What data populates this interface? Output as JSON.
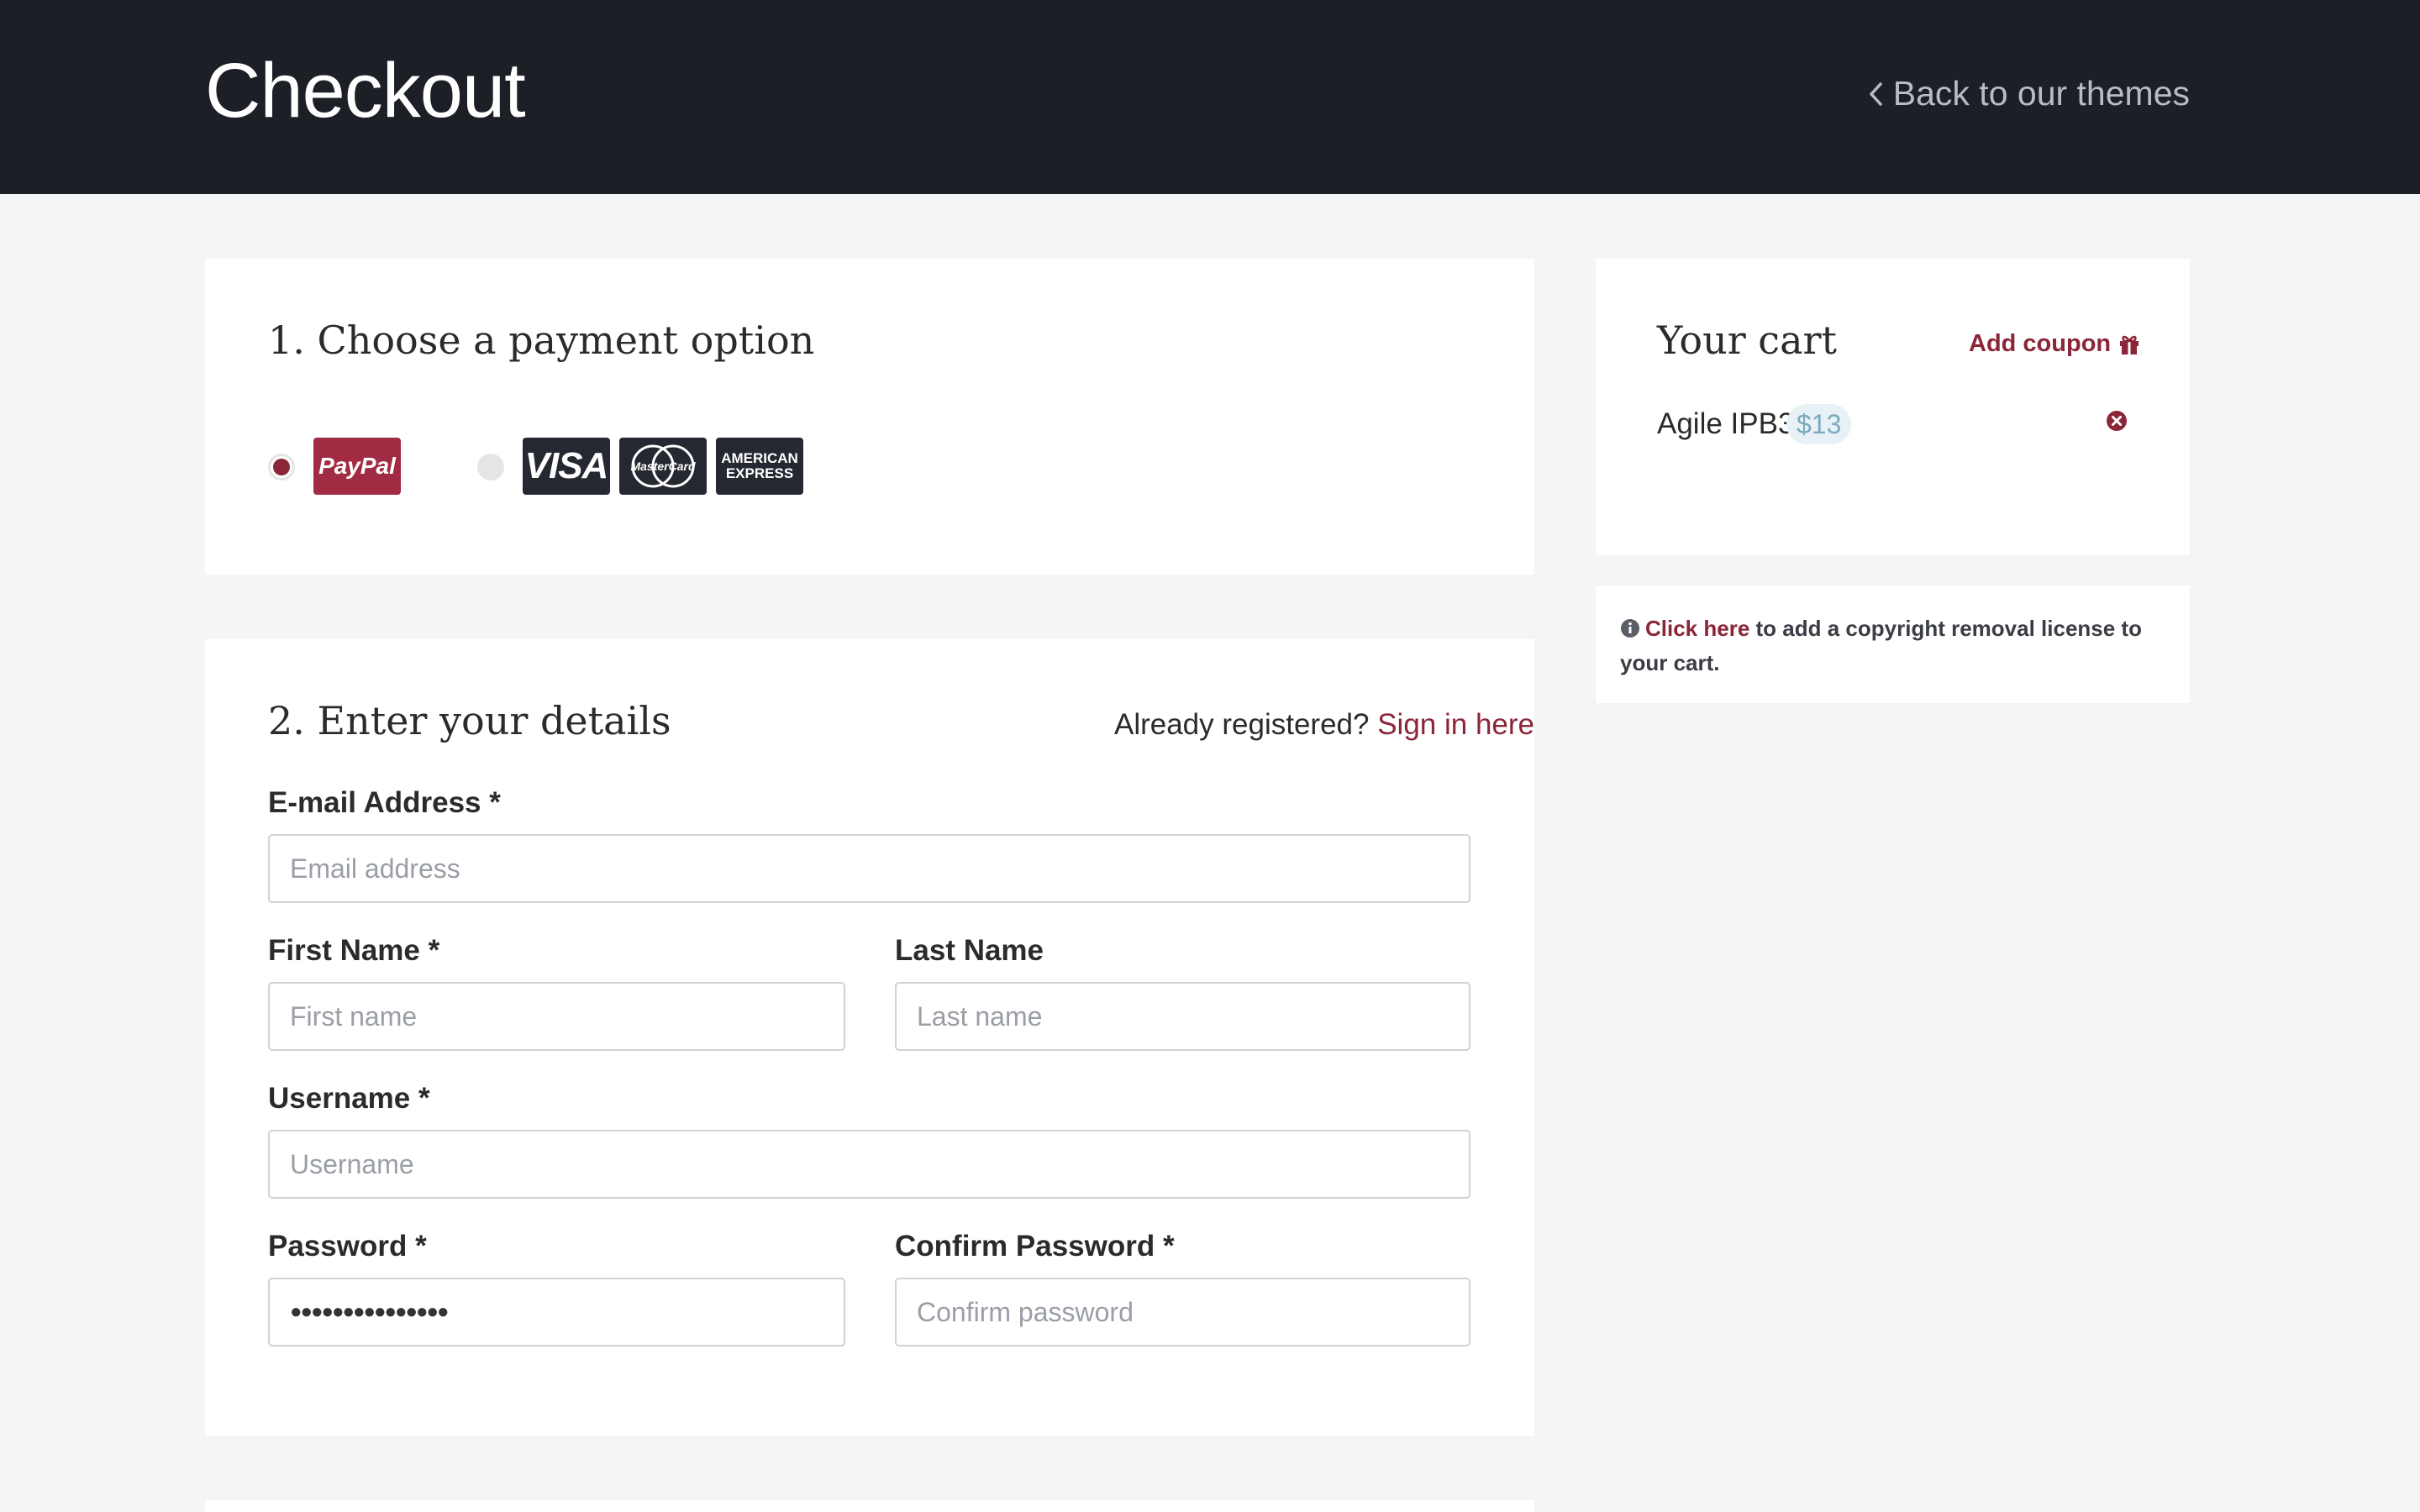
{
  "header": {
    "title": "Checkout",
    "back_label": "Back to our themes"
  },
  "payment": {
    "title": "1. Choose a payment option",
    "options": [
      {
        "name": "PayPal",
        "selected": true
      },
      {
        "name": "Cards",
        "selected": false
      }
    ],
    "logos": {
      "paypal": "PayPal",
      "visa": "VISA",
      "mastercard": "MasterCard",
      "amex_line1": "AMERICAN",
      "amex_line2": "EXPRESS"
    }
  },
  "details": {
    "title": "2. Enter your details",
    "already_registered": "Already registered?",
    "sign_in_label": "Sign in here",
    "fields": {
      "email_label": "E-mail Address *",
      "email_placeholder": "Email address",
      "first_label": "First Name *",
      "first_placeholder": "First name",
      "last_label": "Last Name",
      "last_placeholder": "Last name",
      "username_label": "Username *",
      "username_placeholder": "Username",
      "password_label": "Password *",
      "password_value": "●●●●●●●●●●●●●●●",
      "confirm_label": "Confirm Password *",
      "confirm_placeholder": "Confirm password"
    }
  },
  "cart": {
    "title": "Your cart",
    "coupon_label": "Add coupon",
    "item_name": "Agile IPB3",
    "item_price": "$13"
  },
  "license": {
    "link_label": "Click here",
    "text": " to add a copyright removal license to your cart."
  },
  "colors": {
    "header_bg": "#1c1f26",
    "accent": "#8b2638",
    "price_badge_bg": "#e8f2f6",
    "price_badge_text": "#7ca9be"
  }
}
